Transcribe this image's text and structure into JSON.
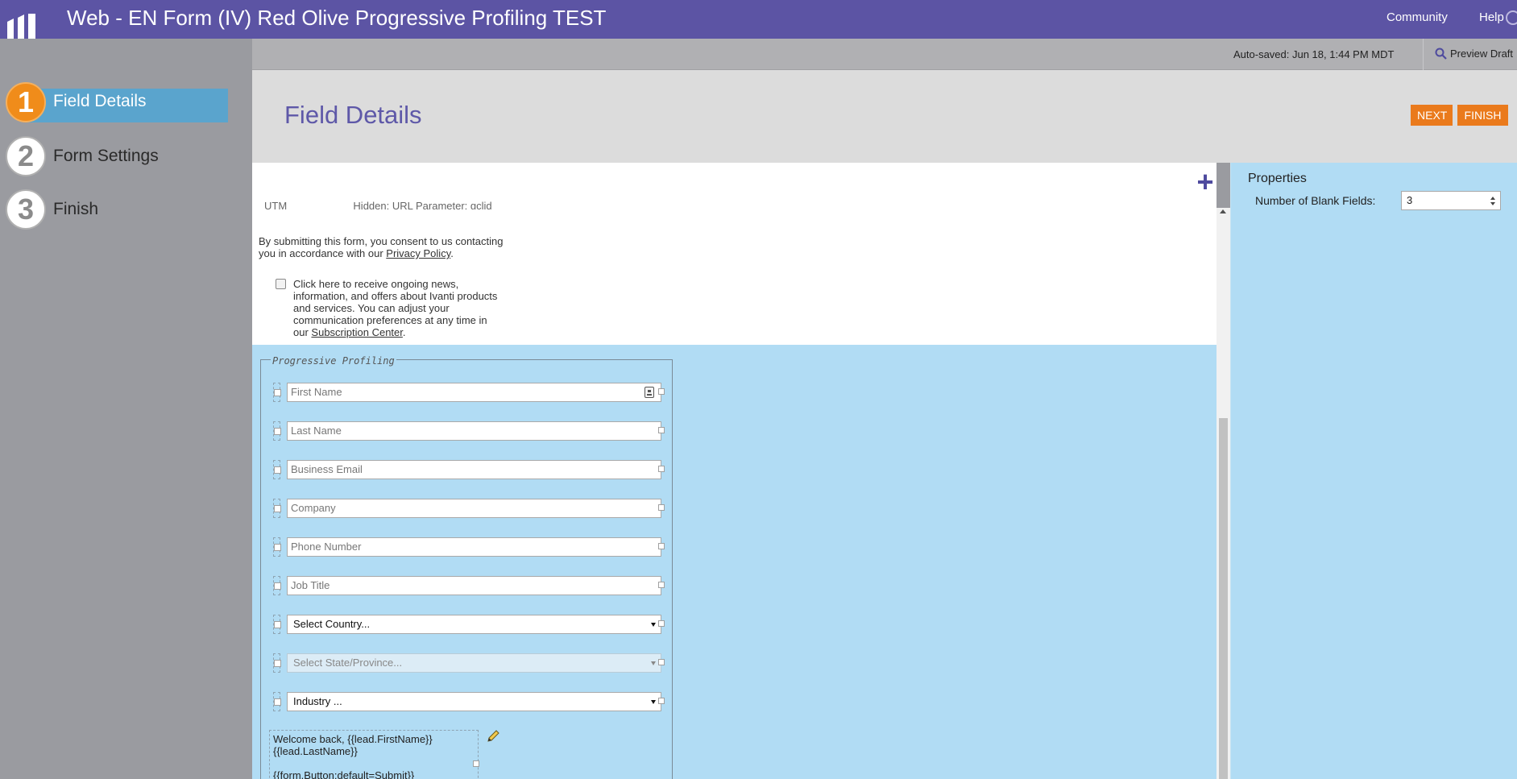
{
  "header": {
    "title": "Web - EN Form (IV) Red Olive Progressive Profiling TEST",
    "community": "Community",
    "help": "Help"
  },
  "steps": [
    {
      "number": "1",
      "label": "Field Details",
      "active": true
    },
    {
      "number": "2",
      "label": "Form Settings",
      "active": false
    },
    {
      "number": "3",
      "label": "Finish",
      "active": false
    }
  ],
  "savebar": {
    "autosave": "Auto-saved: Jun 18, 1:44 PM MDT",
    "preview": "Preview Draft"
  },
  "page": {
    "title": "Field Details",
    "next": "NEXT",
    "finish": "FINISH"
  },
  "canvas": {
    "cutoff_left": "UTM",
    "cutoff_right": "Hidden: URL Parameter: gclid",
    "consent_text": "By submitting this form, you consent to us contacting you in accordance with our",
    "privacy_link": "Privacy Policy",
    "optin_text": "Click here to receive ongoing news, information, and offers about Ivanti products and services. You can adjust your communication preferences at any time in our",
    "subscription_link": "Subscription Center",
    "pp_legend": "Progressive Profiling",
    "fields": {
      "first_name": "First Name",
      "last_name": "Last Name",
      "email": "Business Email",
      "company": "Company",
      "phone": "Phone Number",
      "job_title": "Job Title",
      "country": "Select Country...",
      "state": "Select State/Province...",
      "industry": "Industry ..."
    },
    "welcome_line1": "Welcome back, {{lead.FirstName}}",
    "welcome_line2": "{{lead.LastName}}",
    "welcome_line3": "{{form.Button:default=Submit}}"
  },
  "properties": {
    "title": "Properties",
    "blank_fields_label": "Number of Blank Fields:",
    "blank_fields_value": "3"
  },
  "colors": {
    "brand": "#5c54a4",
    "accent": "#ea7a1c",
    "active_step": "#5aa4cd",
    "canvas_blue": "#b1dcf4"
  }
}
